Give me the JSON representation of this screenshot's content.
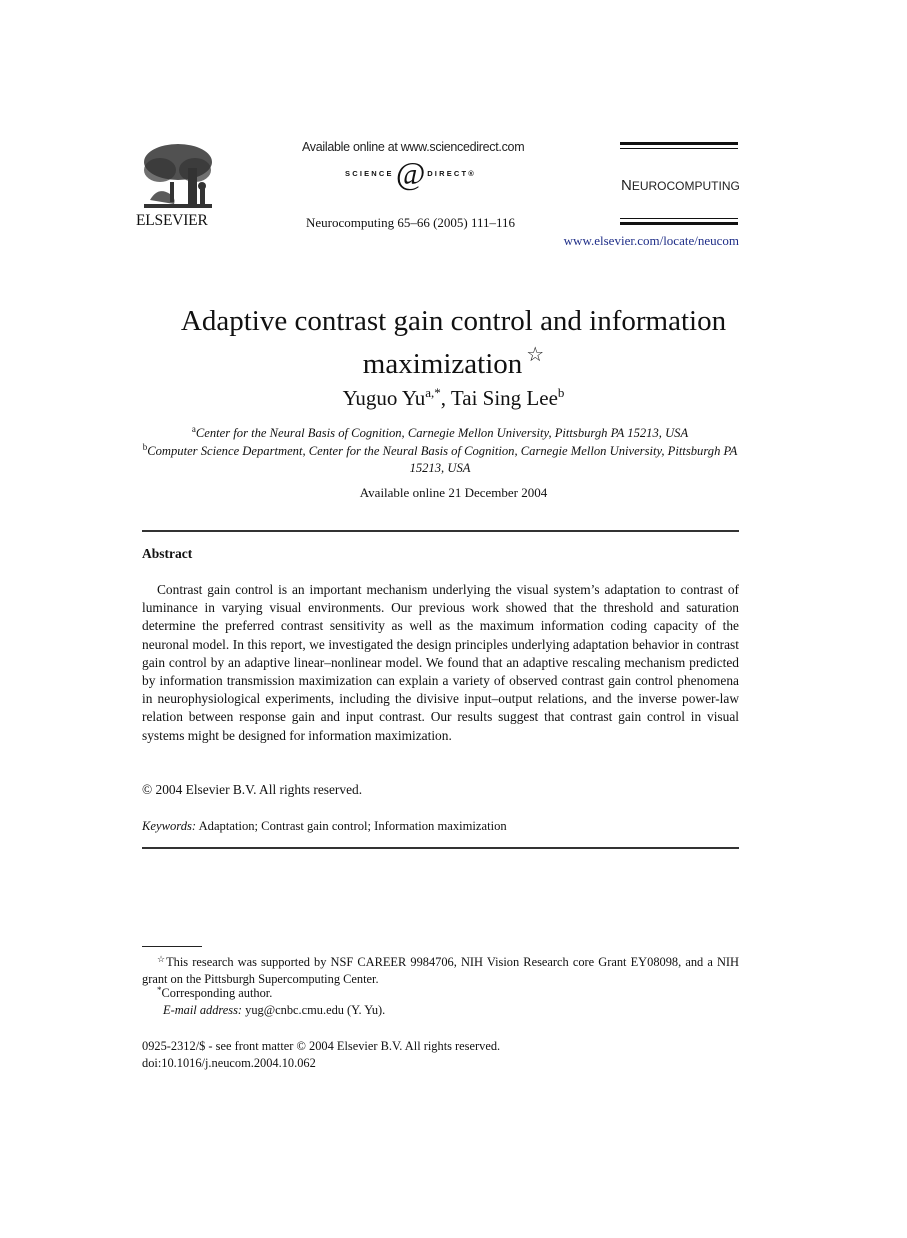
{
  "header": {
    "publisher_logo_text": "ELSEVIER",
    "sciencedirect_available": "Available online at www.sciencedirect.com",
    "sciencedirect_left": "SCIENCE",
    "sciencedirect_at": "@",
    "sciencedirect_right": "DIRECT®",
    "journal_citation": "Neurocomputing 65–66 (2005) 111–116",
    "journal_name_initial": "N",
    "journal_name_rest": "EUROCOMPUTING",
    "journal_url": "www.elsevier.com/locate/neucom",
    "logo_icon": "elsevier-tree-icon"
  },
  "article": {
    "title_line1": "Adaptive contrast gain control and information",
    "title_line2": "maximization",
    "title_footnote_mark": "☆",
    "authors": [
      {
        "name": "Yuguo Yu",
        "marks": "a,*"
      },
      {
        "name": "Tai Sing Lee",
        "marks": "b"
      }
    ],
    "author_separator": ", ",
    "affiliations": [
      {
        "mark": "a",
        "text": "Center for the Neural Basis of Cognition, Carnegie Mellon University, Pittsburgh PA 15213, USA"
      },
      {
        "mark": "b",
        "text": "Computer Science Department, Center for the Neural Basis of Cognition, Carnegie Mellon University, Pittsburgh PA 15213, USA"
      }
    ],
    "available_online": "Available online 21 December 2004"
  },
  "abstract": {
    "heading": "Abstract",
    "body": "Contrast gain control is an important mechanism underlying the visual system’s adaptation to contrast of luminance in varying visual environments. Our previous work showed that the threshold and saturation determine the preferred contrast sensitivity as well as the maximum information coding capacity of the neuronal model. In this report, we investigated the design principles underlying adaptation behavior in contrast gain control by an adaptive linear–nonlinear model. We found that an adaptive rescaling mechanism predicted by information transmission maximization can explain a variety of observed contrast gain control phenomena in neurophysiological experiments, including the divisive input–output relations, and the inverse power-law relation between response gain and input contrast. Our results suggest that contrast gain control in visual systems might be designed for information maximization.",
    "copyright": "© 2004 Elsevier B.V. All rights reserved."
  },
  "keywords": {
    "label": "Keywords:",
    "text": "Adaptation; Contrast gain control; Information maximization"
  },
  "footnotes": {
    "funding_mark": "☆",
    "funding": "This research was supported by NSF CAREER 9984706, NIH Vision Research core Grant EY08098, and a NIH grant on the Pittsburgh Supercomputing Center.",
    "corresponding_mark": "*",
    "corresponding": "Corresponding author.",
    "email_label": "E-mail address:",
    "email": "yug@cnbc.cmu.edu (Y. Yu)."
  },
  "front_matter": {
    "issn": "0925-2312/$ - see front matter © 2004 Elsevier B.V. All rights reserved.",
    "doi": "doi:10.1016/j.neucom.2004.10.062"
  }
}
